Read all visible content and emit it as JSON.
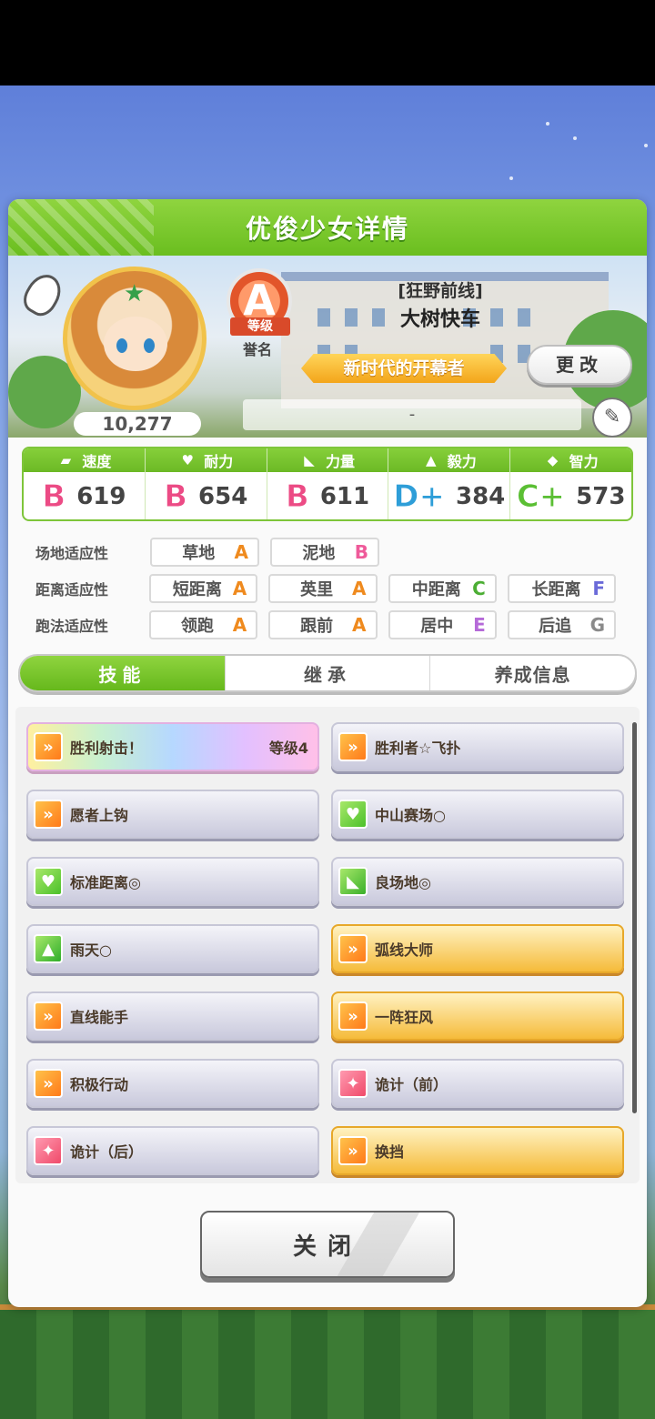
{
  "panel": {
    "title": "优俊少女详情"
  },
  "profile": {
    "fans": "10,277",
    "rank_letter": "A",
    "rank_ribbon": "等级",
    "rank_label": "誉名",
    "epithet": "[狂野前线]",
    "name": "大树快车",
    "title_banner": "新时代的开幕者",
    "change_label": "更改",
    "memo": "-"
  },
  "stats": [
    {
      "label": "速度",
      "grade": "B",
      "value": "619",
      "icon": "shoe-icon"
    },
    {
      "label": "耐力",
      "grade": "B",
      "value": "654",
      "icon": "heart-icon"
    },
    {
      "label": "力量",
      "grade": "B",
      "value": "611",
      "icon": "muscle-icon"
    },
    {
      "label": "毅力",
      "grade": "D+",
      "value": "384",
      "icon": "flame-icon"
    },
    {
      "label": "智力",
      "grade": "C+",
      "value": "573",
      "icon": "graduation-cap-icon"
    }
  ],
  "aptitude": {
    "track": {
      "label": "场地适应性",
      "items": [
        {
          "name": "草地",
          "grade": "A"
        },
        {
          "name": "泥地",
          "grade": "B"
        }
      ]
    },
    "distance": {
      "label": "距离适应性",
      "items": [
        {
          "name": "短距离",
          "grade": "A"
        },
        {
          "name": "英里",
          "grade": "A"
        },
        {
          "name": "中距离",
          "grade": "C"
        },
        {
          "name": "长距离",
          "grade": "F"
        }
      ]
    },
    "strategy": {
      "label": "跑法适应性",
      "items": [
        {
          "name": "领跑",
          "grade": "A"
        },
        {
          "name": "跟前",
          "grade": "A"
        },
        {
          "name": "居中",
          "grade": "E"
        },
        {
          "name": "后追",
          "grade": "G"
        }
      ]
    }
  },
  "tabs": [
    "技能",
    "继承",
    "养成信息"
  ],
  "skills": [
    {
      "name": "胜利射击！",
      "level": "等级4",
      "icon": "speed-icon",
      "style": "rainbow"
    },
    {
      "name": "胜利者☆飞扑",
      "level": "",
      "icon": "speed-icon",
      "style": "normal"
    },
    {
      "name": "愿者上钩",
      "level": "",
      "icon": "speed-icon",
      "style": "normal"
    },
    {
      "name": "中山赛场○",
      "level": "",
      "icon": "heart-icon",
      "style": "normal"
    },
    {
      "name": "标准距离◎",
      "level": "",
      "icon": "heart-icon",
      "style": "normal"
    },
    {
      "name": "良场地◎",
      "level": "",
      "icon": "power-icon",
      "style": "normal"
    },
    {
      "name": "雨天○",
      "level": "",
      "icon": "fire-icon",
      "style": "normal"
    },
    {
      "name": "弧线大师",
      "level": "",
      "icon": "speed-icon",
      "style": "gold"
    },
    {
      "name": "直线能手",
      "level": "",
      "icon": "speed-icon",
      "style": "normal"
    },
    {
      "name": "一阵狂风",
      "level": "",
      "icon": "speed-icon",
      "style": "gold"
    },
    {
      "name": "积极行动",
      "level": "",
      "icon": "speed-icon",
      "style": "normal"
    },
    {
      "name": "诡计（前）",
      "level": "",
      "icon": "sparkle-icon",
      "style": "normal"
    },
    {
      "name": "诡计（后）",
      "level": "",
      "icon": "sparkle-icon",
      "style": "normal"
    },
    {
      "name": "换挡",
      "level": "",
      "icon": "speed-icon",
      "style": "gold"
    }
  ],
  "close_label": "关闭"
}
